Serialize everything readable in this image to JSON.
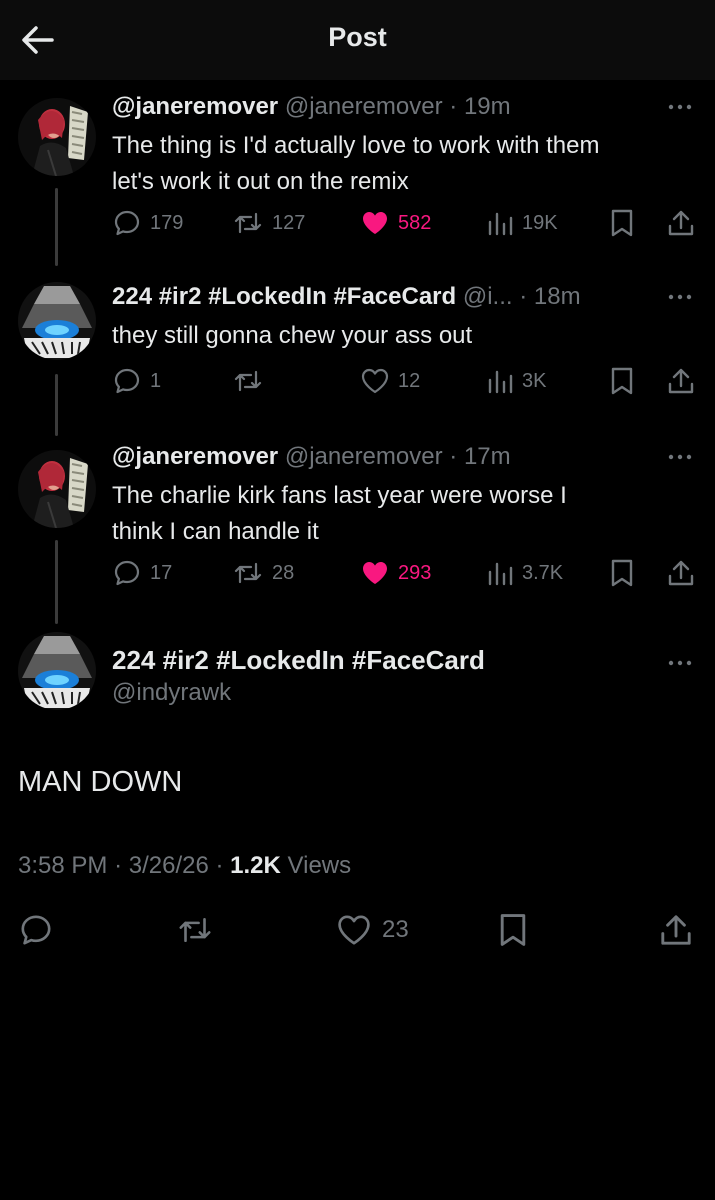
{
  "header": {
    "title": "Post"
  },
  "replies": [
    {
      "author_name": "@janeremover",
      "handle": "@janeremover",
      "time": "19m",
      "text_lines": [
        "The thing is I'd actually love to work with them",
        "let's work it out on the remix"
      ],
      "replies": "179",
      "reposts": "127",
      "likes": "582",
      "views": "19K",
      "liked": true
    },
    {
      "author_name": "224 #ir2 #LockedIn #FaceCard",
      "handle": "@i...",
      "time": "18m",
      "text_lines": [
        "they still gonna chew your ass out"
      ],
      "replies": "1",
      "reposts": "",
      "likes": "12",
      "views": "3K",
      "liked": false
    },
    {
      "author_name": "@janeremover",
      "handle": "@janeremover",
      "time": "17m",
      "text_lines": [
        "The charlie kirk fans last year were worse I",
        "think I can handle it"
      ],
      "replies": "17",
      "reposts": "28",
      "likes": "293",
      "views": "3.7K",
      "liked": true
    }
  ],
  "main_post": {
    "author_name": "224 #ir2 #LockedIn #FaceCard",
    "handle": "@indyrawk",
    "text": "MAN DOWN",
    "time": "3:58 PM",
    "date": "3/26/26",
    "views_count": "1.2K",
    "views_label": "Views",
    "likes": "23"
  },
  "colors": {
    "accent_like": "#f91880",
    "muted": "#71767b",
    "text": "#e7e9ea",
    "background": "#000000"
  },
  "icons": [
    "back-arrow-icon",
    "more-icon",
    "reply-icon",
    "repost-icon",
    "like-icon",
    "views-icon",
    "bookmark-icon",
    "share-icon"
  ]
}
